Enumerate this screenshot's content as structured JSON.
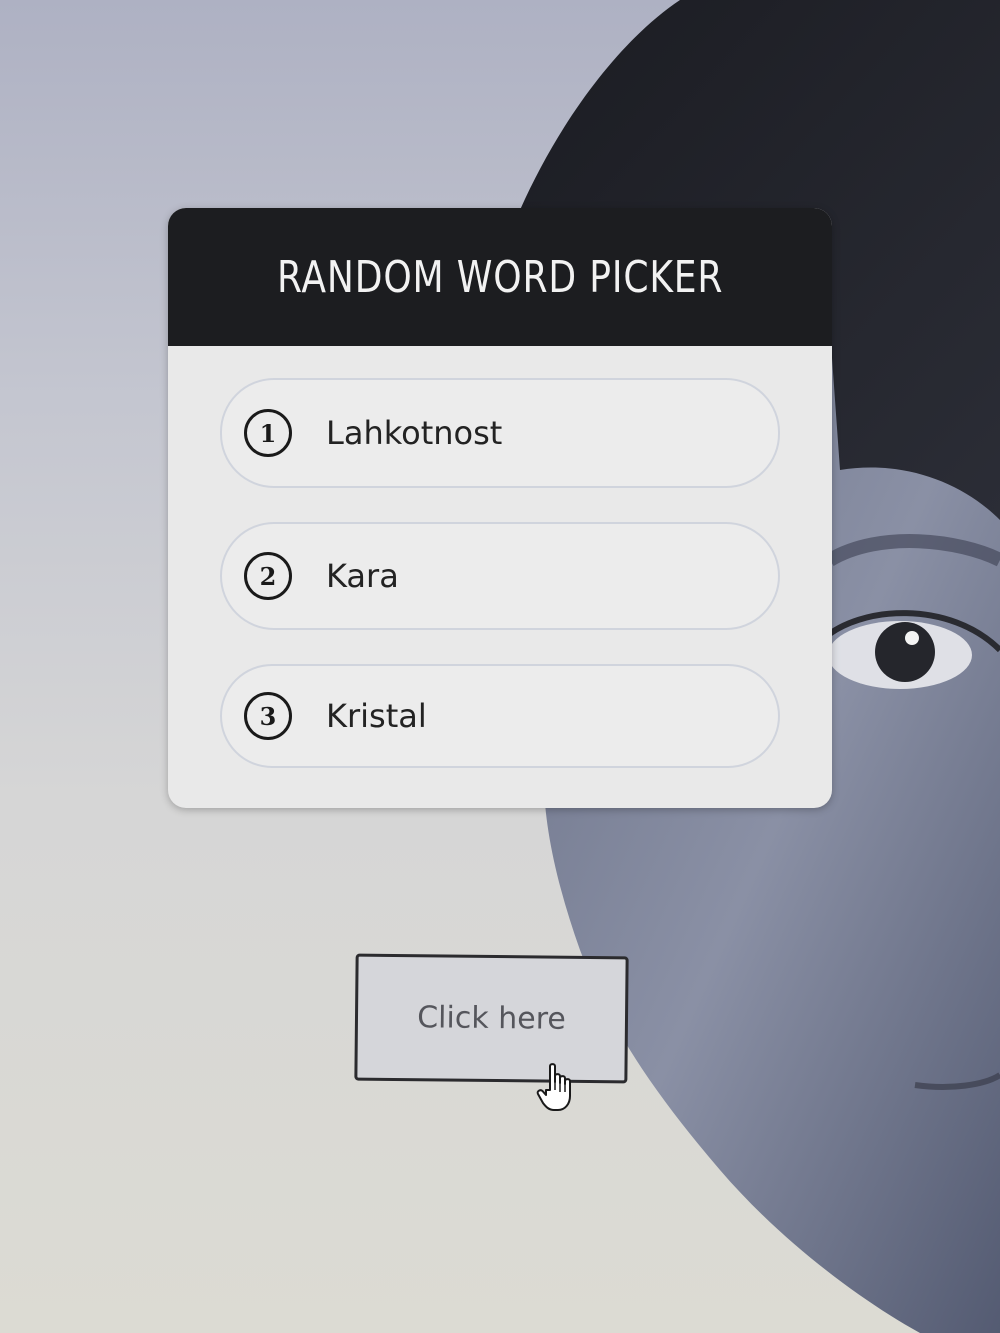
{
  "widget": {
    "title": "RANDOM WORD PICKER",
    "words": [
      {
        "number": "1",
        "text": "Lahkotnost"
      },
      {
        "number": "2",
        "text": "Kara"
      },
      {
        "number": "3",
        "text": "Kristal"
      }
    ]
  },
  "action": {
    "button_label": "Click here"
  },
  "icons": {
    "cursor": "hand-pointer-icon"
  },
  "colors": {
    "header_bg": "#1c1d20",
    "card_bg": "#e9e9e9",
    "item_border": "#d0d4dd",
    "button_border": "#2b2b2e"
  }
}
